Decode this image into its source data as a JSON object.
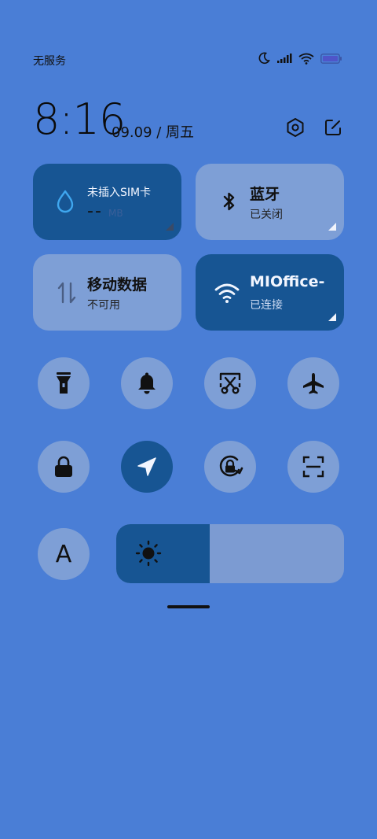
{
  "status_bar": {
    "carrier": "无服务",
    "icons": [
      "moon-icon",
      "signal-icon",
      "wifi-icon",
      "battery-icon"
    ]
  },
  "clock": {
    "time": "8:16",
    "date": "09.09 / 周五",
    "actions": [
      "settings-icon",
      "edit-icon"
    ]
  },
  "tiles": {
    "data_usage": {
      "title": "未插入SIM卡",
      "value": "--",
      "unit": "MB",
      "icon": "droplet-icon",
      "state": "on"
    },
    "bluetooth": {
      "title": "蓝牙",
      "subtitle": "已关闭",
      "icon": "bluetooth-icon",
      "state": "off"
    },
    "mobile_data": {
      "title": "移动数据",
      "subtitle": "不可用",
      "icon": "mobile-data-icon",
      "state": "off"
    },
    "wifi": {
      "title": "MIOffice-",
      "subtitle": "已连接",
      "icon": "wifi-icon",
      "state": "on"
    }
  },
  "toggles": [
    {
      "icon": "flashlight-icon",
      "state": "off"
    },
    {
      "icon": "bell-icon",
      "state": "off"
    },
    {
      "icon": "screenshot-icon",
      "state": "off"
    },
    {
      "icon": "airplane-icon",
      "state": "off"
    },
    {
      "icon": "lock-icon",
      "state": "off"
    },
    {
      "icon": "location-icon",
      "state": "on"
    },
    {
      "icon": "rotation-lock-icon",
      "state": "off"
    },
    {
      "icon": "scan-icon",
      "state": "off"
    }
  ],
  "font_toggle": {
    "label": "A",
    "state": "off"
  },
  "brightness": {
    "level": 0.41,
    "icon": "sun-icon"
  },
  "colors": {
    "background": "#4a7ed6",
    "tile_on": "#175593",
    "tile_off": "#7e9fd6"
  }
}
